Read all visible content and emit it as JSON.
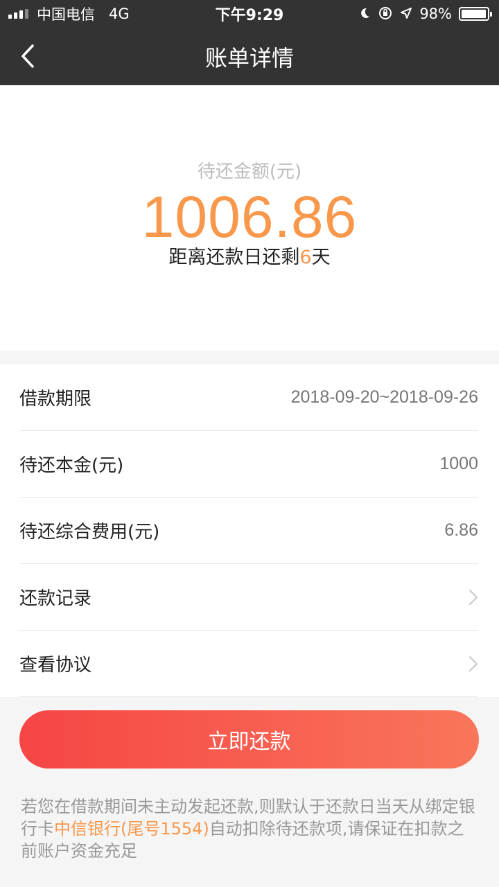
{
  "status_bar": {
    "carrier": "中国电信",
    "network": "4G",
    "time": "下午9:29",
    "battery": "98%",
    "battery_level": 0.98
  },
  "nav": {
    "title": "账单详情"
  },
  "summary": {
    "amount_label": "待还金额(元)",
    "amount": "1006.86",
    "due_prefix": "距离还款日还剩",
    "due_days": "6",
    "due_suffix": "天"
  },
  "details": {
    "rows": [
      {
        "label": "借款期限",
        "value": "2018-09-20~2018-09-26"
      },
      {
        "label": "待还本金(元)",
        "value": "1000"
      },
      {
        "label": "待还综合费用(元)",
        "value": "6.86"
      },
      {
        "label": "还款记录"
      },
      {
        "label": "查看协议"
      }
    ]
  },
  "button": {
    "label": "立即还款"
  },
  "notice": {
    "part1": "若您在借款期间未主动发起还款,则默认于还款日当天从绑定银行卡",
    "bank": "中信银行(尾号1554)",
    "part2": "自动扣除待还款项,请保证在扣款之前账户资金充足"
  },
  "colors": {
    "accent": "#f9974a",
    "button_start": "#f64545",
    "button_end": "#f9765a",
    "header": "#333333"
  }
}
